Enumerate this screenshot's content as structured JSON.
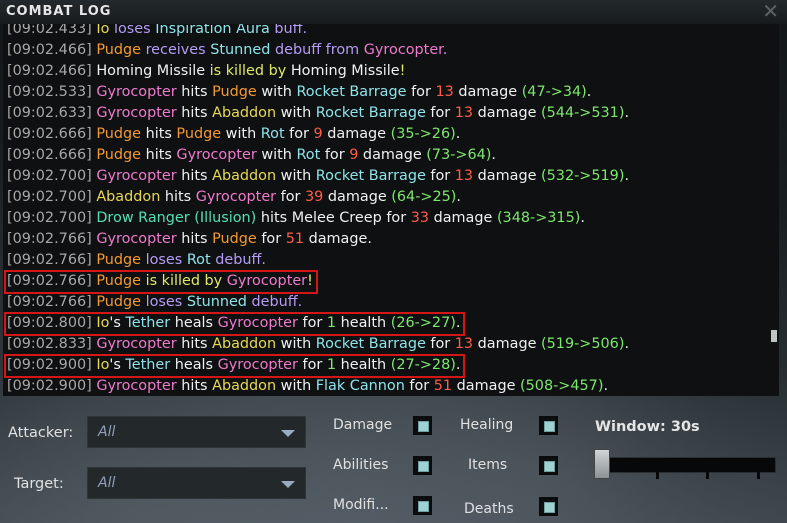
{
  "window": {
    "title": "COMBAT LOG",
    "close_label": "✕"
  },
  "log": {
    "lines": [
      [
        [
          "[09:02.433] ",
          "ts"
        ],
        [
          "Io",
          "t-yellow"
        ],
        [
          " loses ",
          "t-purple"
        ],
        [
          "Inspiration Aura",
          "t-teal"
        ],
        [
          " buff.",
          "t-purple"
        ]
      ],
      [
        [
          "[09:02.466] ",
          "ts"
        ],
        [
          "Pudge",
          "t-orange"
        ],
        [
          " receives ",
          "t-purple"
        ],
        [
          "Stunned",
          "t-teal"
        ],
        [
          " debuff from ",
          "t-purple"
        ],
        [
          "Gyrocopter",
          "t-pink"
        ],
        [
          ".",
          "t-purple"
        ]
      ],
      [
        [
          "[09:02.466] ",
          "ts"
        ],
        [
          "Homing Missile",
          "t-white"
        ],
        [
          " is killed by ",
          "t-yellowgreen"
        ],
        [
          "Homing Missile",
          "t-white"
        ],
        [
          "!",
          "t-yellowgreen"
        ]
      ],
      [
        [
          "[09:02.533] ",
          "ts"
        ],
        [
          "Gyrocopter",
          "t-pink"
        ],
        [
          " hits ",
          "t-white"
        ],
        [
          "Pudge",
          "t-orange"
        ],
        [
          " with ",
          "t-white"
        ],
        [
          "Rocket Barrage",
          "t-teal"
        ],
        [
          " for ",
          "t-white"
        ],
        [
          "13",
          "t-red"
        ],
        [
          " damage ",
          "t-white"
        ],
        [
          "(47->34)",
          "t-green"
        ],
        [
          ".",
          "t-white"
        ]
      ],
      [
        [
          "[09:02.633] ",
          "ts"
        ],
        [
          "Gyrocopter",
          "t-pink"
        ],
        [
          " hits ",
          "t-white"
        ],
        [
          "Abaddon",
          "t-yellow"
        ],
        [
          " with ",
          "t-white"
        ],
        [
          "Rocket Barrage",
          "t-teal"
        ],
        [
          " for ",
          "t-white"
        ],
        [
          "13",
          "t-red"
        ],
        [
          " damage ",
          "t-white"
        ],
        [
          "(544->531)",
          "t-green"
        ],
        [
          ".",
          "t-white"
        ]
      ],
      [
        [
          "[09:02.666] ",
          "ts"
        ],
        [
          "Pudge",
          "t-orange"
        ],
        [
          " hits ",
          "t-white"
        ],
        [
          "Pudge",
          "t-orange"
        ],
        [
          " with ",
          "t-white"
        ],
        [
          "Rot",
          "t-teal"
        ],
        [
          " for ",
          "t-white"
        ],
        [
          "9",
          "t-red"
        ],
        [
          " damage ",
          "t-white"
        ],
        [
          "(35->26)",
          "t-green"
        ],
        [
          ".",
          "t-white"
        ]
      ],
      [
        [
          "[09:02.666] ",
          "ts"
        ],
        [
          "Pudge",
          "t-orange"
        ],
        [
          " hits ",
          "t-white"
        ],
        [
          "Gyrocopter",
          "t-pink"
        ],
        [
          " with ",
          "t-white"
        ],
        [
          "Rot",
          "t-teal"
        ],
        [
          " for ",
          "t-white"
        ],
        [
          "9",
          "t-red"
        ],
        [
          " damage ",
          "t-white"
        ],
        [
          "(73->64)",
          "t-green"
        ],
        [
          ".",
          "t-white"
        ]
      ],
      [
        [
          "[09:02.700] ",
          "ts"
        ],
        [
          "Gyrocopter",
          "t-pink"
        ],
        [
          " hits ",
          "t-white"
        ],
        [
          "Abaddon",
          "t-yellow"
        ],
        [
          " with ",
          "t-white"
        ],
        [
          "Rocket Barrage",
          "t-teal"
        ],
        [
          " for ",
          "t-white"
        ],
        [
          "13",
          "t-red"
        ],
        [
          " damage ",
          "t-white"
        ],
        [
          "(532->519)",
          "t-green"
        ],
        [
          ".",
          "t-white"
        ]
      ],
      [
        [
          "[09:02.700] ",
          "ts"
        ],
        [
          "Abaddon",
          "t-yellow"
        ],
        [
          " hits ",
          "t-white"
        ],
        [
          "Gyrocopter",
          "t-pink"
        ],
        [
          " for ",
          "t-white"
        ],
        [
          "39",
          "t-red"
        ],
        [
          " damage ",
          "t-white"
        ],
        [
          "(64->25)",
          "t-green"
        ],
        [
          ".",
          "t-white"
        ]
      ],
      [
        [
          "[09:02.700] ",
          "ts"
        ],
        [
          "Drow Ranger (Illusion)",
          "t-cyan"
        ],
        [
          " hits ",
          "t-white"
        ],
        [
          "Melee Creep",
          "t-white"
        ],
        [
          " for ",
          "t-white"
        ],
        [
          "33",
          "t-red"
        ],
        [
          " damage ",
          "t-white"
        ],
        [
          "(348->315)",
          "t-green"
        ],
        [
          ".",
          "t-white"
        ]
      ],
      [
        [
          "[09:02.766] ",
          "ts"
        ],
        [
          "Gyrocopter",
          "t-pink"
        ],
        [
          " hits ",
          "t-white"
        ],
        [
          "Pudge",
          "t-orange"
        ],
        [
          " for ",
          "t-white"
        ],
        [
          "51",
          "t-red"
        ],
        [
          " damage.",
          "t-white"
        ]
      ],
      [
        [
          "[09:02.766] ",
          "ts"
        ],
        [
          "Pudge",
          "t-orange"
        ],
        [
          " loses ",
          "t-purple"
        ],
        [
          "Rot",
          "t-teal"
        ],
        [
          " debuff.",
          "t-purple"
        ]
      ],
      [
        [
          "[09:02.766] ",
          "ts"
        ],
        [
          "Pudge",
          "t-orange"
        ],
        [
          " is killed by ",
          "t-yellowgreen"
        ],
        [
          "Gyrocopter",
          "t-pink"
        ],
        [
          "!",
          "t-yellowgreen"
        ]
      ],
      [
        [
          "[09:02.766] ",
          "ts"
        ],
        [
          "Pudge",
          "t-orange"
        ],
        [
          " loses ",
          "t-purple"
        ],
        [
          "Stunned",
          "t-teal"
        ],
        [
          " debuff.",
          "t-purple"
        ]
      ],
      [
        [
          "[09:02.800] ",
          "ts"
        ],
        [
          "Io",
          "t-yellow"
        ],
        [
          "'s ",
          "t-white"
        ],
        [
          "Tether",
          "t-teal"
        ],
        [
          " heals ",
          "t-white"
        ],
        [
          "Gyrocopter",
          "t-pink"
        ],
        [
          " for ",
          "t-white"
        ],
        [
          "1",
          "t-green"
        ],
        [
          " health ",
          "t-white"
        ],
        [
          "(26->27)",
          "t-green"
        ],
        [
          ".",
          "t-white"
        ]
      ],
      [
        [
          "[09:02.833] ",
          "ts"
        ],
        [
          "Gyrocopter",
          "t-pink"
        ],
        [
          " hits ",
          "t-white"
        ],
        [
          "Abaddon",
          "t-yellow"
        ],
        [
          " with ",
          "t-white"
        ],
        [
          "Rocket Barrage",
          "t-teal"
        ],
        [
          " for ",
          "t-white"
        ],
        [
          "13",
          "t-red"
        ],
        [
          " damage ",
          "t-white"
        ],
        [
          "(519->506)",
          "t-green"
        ],
        [
          ".",
          "t-white"
        ]
      ],
      [
        [
          "[09:02.900] ",
          "ts"
        ],
        [
          "Io",
          "t-yellow"
        ],
        [
          "'s ",
          "t-white"
        ],
        [
          "Tether",
          "t-teal"
        ],
        [
          " heals ",
          "t-white"
        ],
        [
          "Gyrocopter",
          "t-pink"
        ],
        [
          " for ",
          "t-white"
        ],
        [
          "1",
          "t-green"
        ],
        [
          " health ",
          "t-white"
        ],
        [
          "(27->28)",
          "t-green"
        ],
        [
          ".",
          "t-white"
        ]
      ],
      [
        [
          "[09:02.900] ",
          "ts"
        ],
        [
          "Gyrocopter",
          "t-pink"
        ],
        [
          " hits ",
          "t-white"
        ],
        [
          "Abaddon",
          "t-yellow"
        ],
        [
          " with ",
          "t-white"
        ],
        [
          "Flak Cannon",
          "t-teal"
        ],
        [
          " for ",
          "t-white"
        ],
        [
          "51",
          "t-red"
        ],
        [
          " damage ",
          "t-white"
        ],
        [
          "(508->457)",
          "t-green"
        ],
        [
          ".",
          "t-white"
        ]
      ]
    ],
    "highlighted_lines": [
      12,
      14,
      16
    ]
  },
  "filters": {
    "attacker_label": "Attacker:",
    "attacker_value": "All",
    "target_label": "Target:",
    "target_value": "All"
  },
  "checkboxes": {
    "damage": "Damage",
    "healing": "Healing",
    "abilities": "Abilities",
    "items": "Items",
    "modifiers": "Modifi...",
    "deaths": "Deaths"
  },
  "window_control": {
    "label": "Window: 30s"
  },
  "colors": {
    "highlight": "#d51616",
    "accent": "#9fd0d2"
  }
}
